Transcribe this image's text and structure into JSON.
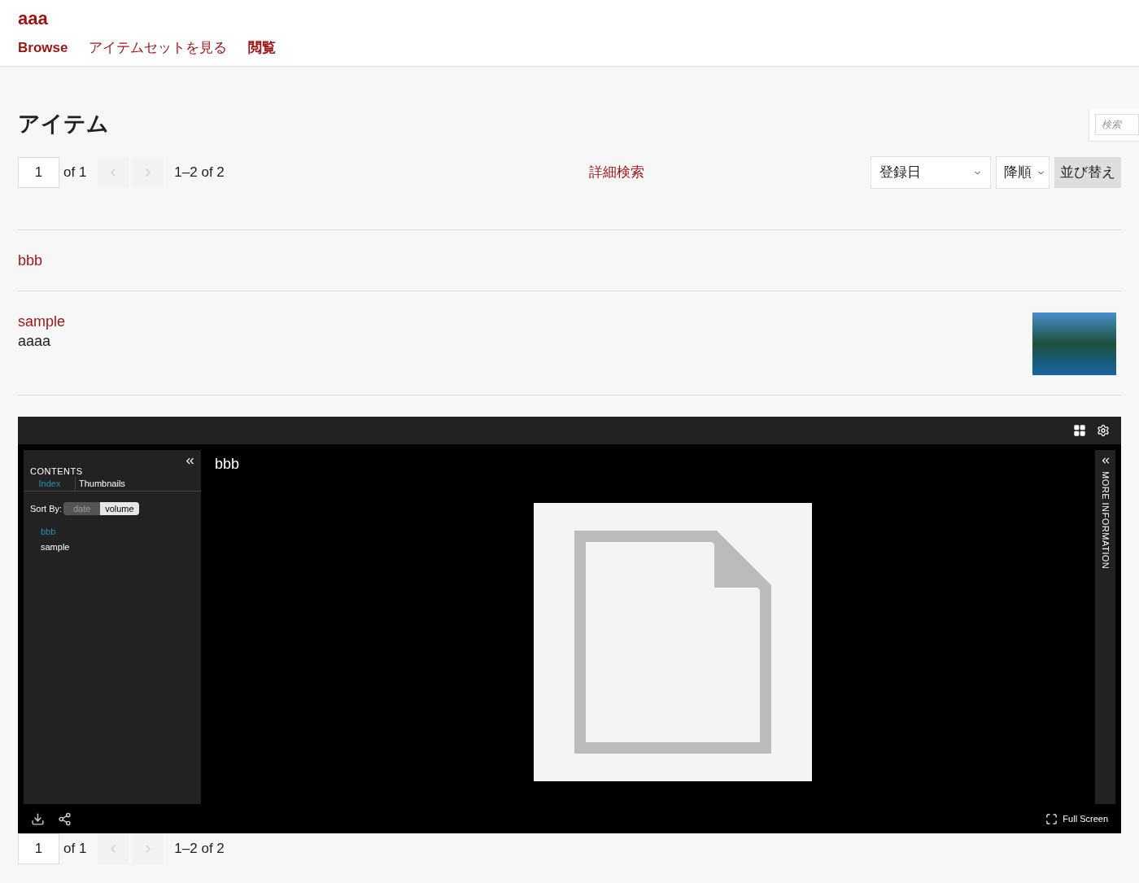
{
  "site_title": "aaa",
  "nav": [
    {
      "label": "Browse",
      "bold": true
    },
    {
      "label": "アイテムセットを見る",
      "bold": false
    },
    {
      "label": "閲覧",
      "bold": true
    }
  ],
  "search": {
    "placeholder": "検索"
  },
  "heading": "アイテム",
  "pager": {
    "page": "1",
    "of": "of 1",
    "range": "1–2 of 2",
    "prev": {
      "disabled": true
    },
    "next": {
      "disabled": true
    }
  },
  "advanced_search": "詳細検索",
  "sort": {
    "field": "登録日",
    "order": "降順",
    "button": "並び替え"
  },
  "items": [
    {
      "title": "bbb",
      "has_thumbnail": false
    },
    {
      "title": "sample",
      "description": "aaaa",
      "has_thumbnail": true
    }
  ],
  "viewer": {
    "title": "bbb",
    "contents_heading": "CONTENTS",
    "tabs": [
      {
        "label": "Index",
        "selected": true
      },
      {
        "label": "Thumbnails",
        "selected": false
      }
    ],
    "sort_label": "Sort By:",
    "sort_options": [
      {
        "label": "date",
        "selected": false
      },
      {
        "label": "volume",
        "selected": true
      }
    ],
    "index_items": [
      {
        "label": "bbb",
        "selected": true
      },
      {
        "label": "sample",
        "selected": false
      }
    ],
    "more_info": "MORE INFORMATION",
    "fullscreen": "Full Screen"
  },
  "bottom_pager": {
    "page": "1",
    "of": "of 1",
    "range": "1–2 of 2",
    "prev": {
      "disabled": true
    },
    "next": {
      "disabled": true
    }
  }
}
